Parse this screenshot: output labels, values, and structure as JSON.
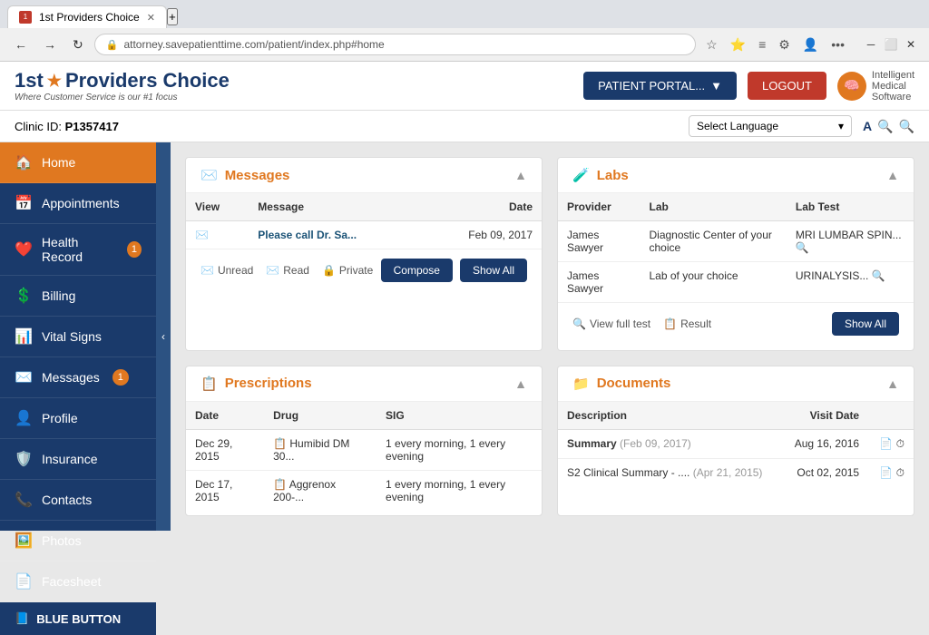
{
  "browser": {
    "tab_label": "1st Providers Choice",
    "address": "attorney.savepatienttime.com/patient/index.php#home",
    "new_tab_icon": "+"
  },
  "header": {
    "logo_first": "1st",
    "logo_star": "★",
    "logo_providers": "Providers Choice",
    "logo_subtitle": "Where Customer Service is our #1 focus",
    "btn_portal": "PATIENT PORTAL...",
    "btn_logout": "LOGOUT",
    "ims_line1": "Intelligent",
    "ims_line2": "Medical",
    "ims_line3": "Software"
  },
  "clinic_bar": {
    "label": "Clinic ID:",
    "id": "P1357417",
    "language_placeholder": "Select Language",
    "a_icon": "A",
    "search1": "🔍",
    "search2": "🔍"
  },
  "sidebar": {
    "items": [
      {
        "id": "home",
        "icon": "🏠",
        "label": "Home",
        "active": true,
        "badge": null
      },
      {
        "id": "appointments",
        "icon": "📅",
        "label": "Appointments",
        "active": false,
        "badge": null
      },
      {
        "id": "health-record",
        "icon": "❤️",
        "label": "Health Record",
        "active": false,
        "badge": "1"
      },
      {
        "id": "billing",
        "icon": "💲",
        "label": "Billing",
        "active": false,
        "badge": null
      },
      {
        "id": "vital-signs",
        "icon": "📊",
        "label": "Vital Signs",
        "active": false,
        "badge": null
      },
      {
        "id": "messages",
        "icon": "✉️",
        "label": "Messages",
        "active": false,
        "badge": "1"
      },
      {
        "id": "profile",
        "icon": "👤",
        "label": "Profile",
        "active": false,
        "badge": null
      },
      {
        "id": "insurance",
        "icon": "🛡️",
        "label": "Insurance",
        "active": false,
        "badge": null
      },
      {
        "id": "contacts",
        "icon": "📞",
        "label": "Contacts",
        "active": false,
        "badge": null
      },
      {
        "id": "photos",
        "icon": "🖼️",
        "label": "Photos",
        "active": false,
        "badge": null
      },
      {
        "id": "facesheet",
        "icon": "📄",
        "label": "Facesheet",
        "active": false,
        "badge": null
      }
    ],
    "blue_button": "BLUE BUTTON"
  },
  "messages_card": {
    "title": "Messages",
    "icon": "✉️",
    "col_view": "View",
    "col_message": "Message",
    "col_date": "Date",
    "rows": [
      {
        "icon": "✉️",
        "message": "Please call Dr. Sa...",
        "date": "Feb 09, 2017"
      }
    ],
    "footer_unread": "Unread",
    "footer_read": "Read",
    "footer_private": "Private",
    "btn_compose": "Compose",
    "btn_show_all": "Show All"
  },
  "labs_card": {
    "title": "Labs",
    "icon": "🧪",
    "col_provider": "Provider",
    "col_lab": "Lab",
    "col_lab_test": "Lab Test",
    "rows": [
      {
        "provider": "James Sawyer",
        "lab": "Diagnostic Center of your choice",
        "lab_test": "MRI LUMBAR SPIN..."
      },
      {
        "provider": "James Sawyer",
        "lab": "Lab of your choice",
        "lab_test": "URINALYSIS..."
      }
    ],
    "footer_view_full": "View full test",
    "footer_result": "Result",
    "btn_show_all": "Show All"
  },
  "prescriptions_card": {
    "title": "Prescriptions",
    "icon": "📋",
    "col_date": "Date",
    "col_drug": "Drug",
    "col_sig": "SIG",
    "rows": [
      {
        "date": "Dec 29, 2015",
        "drug": "Humibid DM 30...",
        "sig": "1 every morning, 1 every evening"
      },
      {
        "date": "Dec 17, 2015",
        "drug": "Aggrenox 200-...",
        "sig": "1 every morning, 1 every evening"
      }
    ]
  },
  "documents_card": {
    "title": "Documents",
    "icon": "📁",
    "col_description": "Description",
    "col_visit_date": "Visit Date",
    "rows": [
      {
        "description": "Summary",
        "date_label": "(Feb 09, 2017)",
        "visit_date": "Aug 16, 2016"
      },
      {
        "description": "S2 Clinical Summary - ...",
        "date_label": "(Apr 21, 2015)",
        "visit_date": "Oct 02, 2015"
      }
    ]
  }
}
